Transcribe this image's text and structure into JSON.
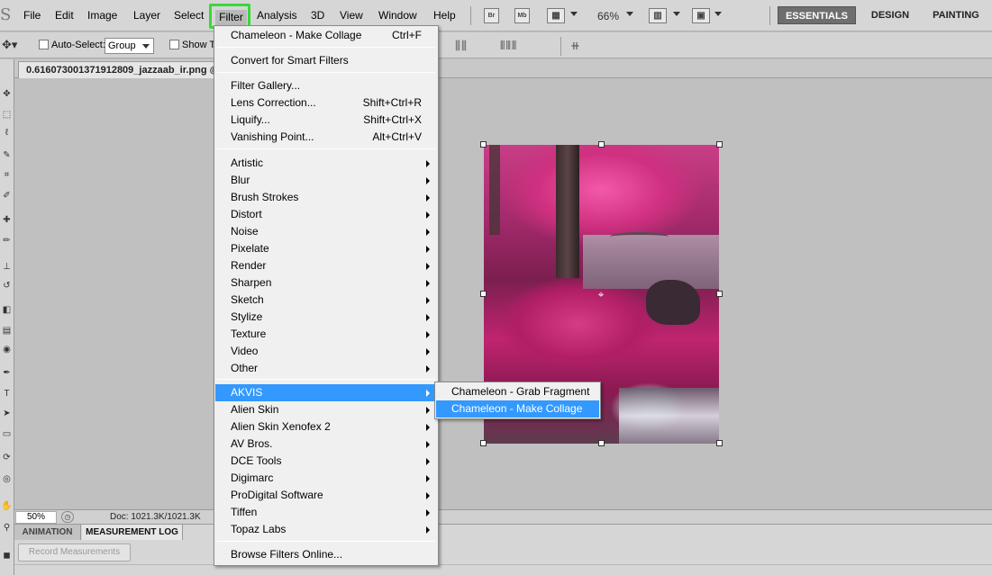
{
  "menubar": {
    "items": [
      "File",
      "Edit",
      "Image",
      "Layer",
      "Select",
      "Filter",
      "Analysis",
      "3D",
      "View",
      "Window",
      "Help"
    ],
    "icons": [
      "Br",
      "Mb"
    ],
    "zoom": "66%",
    "workspaces": [
      "ESSENTIALS",
      "DESIGN",
      "PAINTING"
    ]
  },
  "options": {
    "auto_select_label": "Auto-Select:",
    "group_value": "Group",
    "show_transform_label": "Show T"
  },
  "document": {
    "tab_title": "0.616073001371912809_jazzaab_ir.png @"
  },
  "filter_menu": {
    "last_filter": {
      "label": "Chameleon - Make Collage",
      "shortcut": "Ctrl+F"
    },
    "smart": "Convert for Smart Filters",
    "group1": [
      {
        "label": "Filter Gallery...",
        "shortcut": ""
      },
      {
        "label": "Lens Correction...",
        "shortcut": "Shift+Ctrl+R"
      },
      {
        "label": "Liquify...",
        "shortcut": "Shift+Ctrl+X"
      },
      {
        "label": "Vanishing Point...",
        "shortcut": "Alt+Ctrl+V"
      }
    ],
    "builtin": [
      "Artistic",
      "Blur",
      "Brush Strokes",
      "Distort",
      "Noise",
      "Pixelate",
      "Render",
      "Sharpen",
      "Sketch",
      "Stylize",
      "Texture",
      "Video",
      "Other"
    ],
    "plugins": [
      "AKVIS",
      "Alien Skin",
      "Alien Skin Xenofex 2",
      "AV Bros.",
      "DCE Tools",
      "Digimarc",
      "ProDigital Software",
      "Tiffen",
      "Topaz Labs"
    ],
    "browse": "Browse Filters Online..."
  },
  "akvis_submenu": [
    "Chameleon - Grab Fragment",
    "Chameleon - Make Collage"
  ],
  "status": {
    "zoom": "50%",
    "doc": "Doc: 1021.3K/1021.3K"
  },
  "bottom_panel": {
    "tabs": [
      "ANIMATION",
      "MEASUREMENT LOG"
    ],
    "record_button": "Record Measurements"
  },
  "colors": {
    "highlight": "#3399ff",
    "filter_outline": "#39d839",
    "photo_pink": "#d63c86"
  }
}
